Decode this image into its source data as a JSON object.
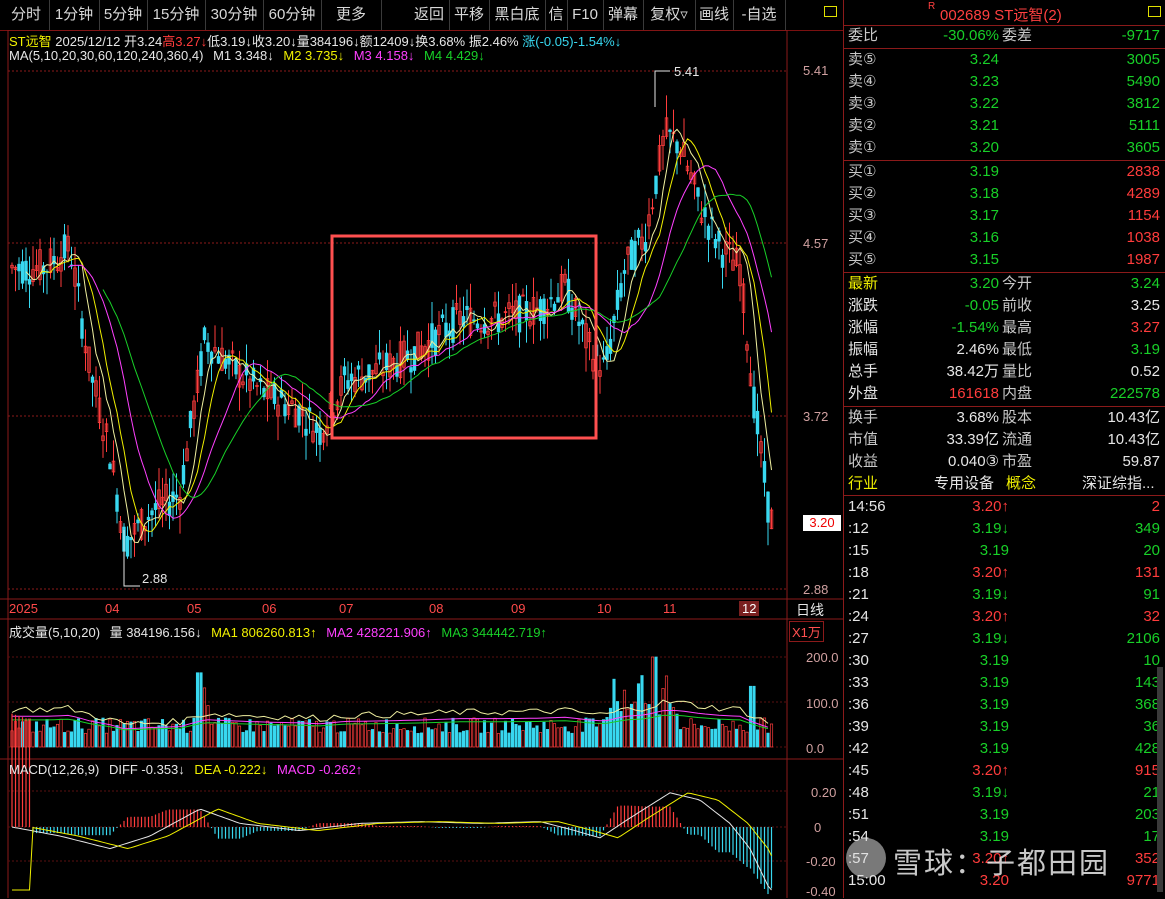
{
  "toolbar": {
    "items": [
      "分时",
      "1分钟",
      "5分钟",
      "15分钟",
      "30分钟",
      "60分钟",
      "更多",
      "返回",
      "平移",
      "黑白底",
      "信",
      "F10",
      "弹幕",
      "复权▿",
      "画线",
      "-自选"
    ]
  },
  "stock": {
    "name": "ST远智",
    "date": "2025/12/12",
    "open": "开3.24",
    "high": "高3.27↓",
    "low": "低3.19↓",
    "close": "收3.20↓",
    "volume": "量384196↓",
    "amount": "额12409↓",
    "turnover": "换3.68%",
    "amplitude": "振2.46%",
    "change": "涨(-0.05)-1.54%↓",
    "code_title": "002689 ST远智(2)",
    "r_mark": "R"
  },
  "ma_line": {
    "label": "MA(5,10,20,30,60,120,240,360,4)",
    "m1": "M1 3.348↓",
    "m2": "M2 3.735↓",
    "m3": "M3 4.158↓",
    "m4": "M4 4.429↓"
  },
  "price_axis": {
    "labels": [
      "5.41",
      "4.57",
      "3.72",
      "2.88"
    ],
    "current": "3.20",
    "max_label": "5.41",
    "min_label": "2.88"
  },
  "date_axis": {
    "labels": [
      "2025",
      "04",
      "05",
      "06",
      "07",
      "08",
      "09",
      "10",
      "11",
      "12"
    ],
    "period": "日线"
  },
  "volume_panel": {
    "label": "成交量(5,10,20)",
    "vol": "量 384196.156↓",
    "ma1": "MA1 806260.813↑",
    "ma2": "MA2 428221.906↑",
    "ma3": "MA3 344442.719↑",
    "unit": "X1万",
    "axis": [
      "200.0",
      "100.0",
      "0.0"
    ]
  },
  "macd_panel": {
    "label": "MACD(12,26,9)",
    "diff": "DIFF -0.353↓",
    "dea": "DEA -0.222↓",
    "macd": "MACD -0.262↑",
    "axis": [
      "0.20",
      "0",
      "-0.20",
      "-0.40"
    ]
  },
  "quote": {
    "weibi_label": "委比",
    "weibi": "-30.06%",
    "weicha_label": "委差",
    "weicha": "-9717",
    "asks": [
      {
        "label": "卖⑤",
        "price": "3.24",
        "vol": "3005"
      },
      {
        "label": "卖④",
        "price": "3.23",
        "vol": "5490"
      },
      {
        "label": "卖③",
        "price": "3.22",
        "vol": "3812"
      },
      {
        "label": "卖②",
        "price": "3.21",
        "vol": "5111"
      },
      {
        "label": "卖①",
        "price": "3.20",
        "vol": "3605"
      }
    ],
    "bids": [
      {
        "label": "买①",
        "price": "3.19",
        "vol": "2838"
      },
      {
        "label": "买②",
        "price": "3.18",
        "vol": "4289"
      },
      {
        "label": "买③",
        "price": "3.17",
        "vol": "1154"
      },
      {
        "label": "买④",
        "price": "3.16",
        "vol": "1038"
      },
      {
        "label": "买⑤",
        "price": "3.15",
        "vol": "1987"
      }
    ],
    "stats": [
      {
        "l1": "最新",
        "v1": "3.20",
        "l2": "今开",
        "v2": "3.24"
      },
      {
        "l1": "涨跌",
        "v1": "-0.05",
        "l2": "前收",
        "v2": "3.25"
      },
      {
        "l1": "涨幅",
        "v1": "-1.54%",
        "l2": "最高",
        "v2": "3.27"
      },
      {
        "l1": "振幅",
        "v1": "2.46%",
        "l2": "最低",
        "v2": "3.19"
      },
      {
        "l1": "总手",
        "v1": "38.42万",
        "l2": "量比",
        "v2": "0.52"
      },
      {
        "l1": "外盘",
        "v1": "161618",
        "l2": "内盘",
        "v2": "222578"
      }
    ],
    "stats2": [
      {
        "l1": "换手",
        "v1": "3.68%",
        "l2": "股本",
        "v2": "10.43亿"
      },
      {
        "l1": "市值",
        "v1": "33.39亿",
        "l2": "流通",
        "v2": "10.43亿"
      },
      {
        "l1": "收益",
        "v1": "0.040③",
        "l2": "市盈",
        "v2": "59.87"
      }
    ],
    "industry_label": "行业",
    "industry": "专用设备",
    "concept_label": "概念",
    "concept": "深证综指..."
  },
  "ticks": [
    {
      "t": "14:56",
      "p": "3.20↑",
      "v": "2",
      "c": "r"
    },
    {
      "t": ":12",
      "p": "3.19↓",
      "v": "349",
      "c": "g"
    },
    {
      "t": ":15",
      "p": "3.19",
      "v": "20",
      "c": "g"
    },
    {
      "t": ":18",
      "p": "3.20↑",
      "v": "131",
      "c": "r"
    },
    {
      "t": ":21",
      "p": "3.19↓",
      "v": "91",
      "c": "g"
    },
    {
      "t": ":24",
      "p": "3.20↑",
      "v": "32",
      "c": "r"
    },
    {
      "t": ":27",
      "p": "3.19↓",
      "v": "2106",
      "c": "g"
    },
    {
      "t": ":30",
      "p": "3.19",
      "v": "10",
      "c": "g"
    },
    {
      "t": ":33",
      "p": "3.19",
      "v": "143",
      "c": "g"
    },
    {
      "t": ":36",
      "p": "3.19",
      "v": "368",
      "c": "g"
    },
    {
      "t": ":39",
      "p": "3.19",
      "v": "36",
      "c": "g"
    },
    {
      "t": ":42",
      "p": "3.19",
      "v": "428",
      "c": "g"
    },
    {
      "t": ":45",
      "p": "3.20↑",
      "v": "915",
      "c": "r"
    },
    {
      "t": ":48",
      "p": "3.19↓",
      "v": "21",
      "c": "g"
    },
    {
      "t": ":51",
      "p": "3.19",
      "v": "203",
      "c": "g"
    },
    {
      "t": ":54",
      "p": "3.19",
      "v": "17",
      "c": "g"
    },
    {
      "t": ":57",
      "p": "3.20↑",
      "v": "352",
      "c": "r"
    },
    {
      "t": "15:00",
      "p": "3.20",
      "v": "9771",
      "c": "r"
    }
  ],
  "watermark": "雪球：子都田园",
  "colors": {
    "up": "#ff3c3c",
    "down": "#38d8f0",
    "ma1": "#f0f0a0",
    "ma2": "#f0f000",
    "ma3": "#ff40ff",
    "ma4": "#18d028",
    "border": "#8b1a1a"
  }
}
